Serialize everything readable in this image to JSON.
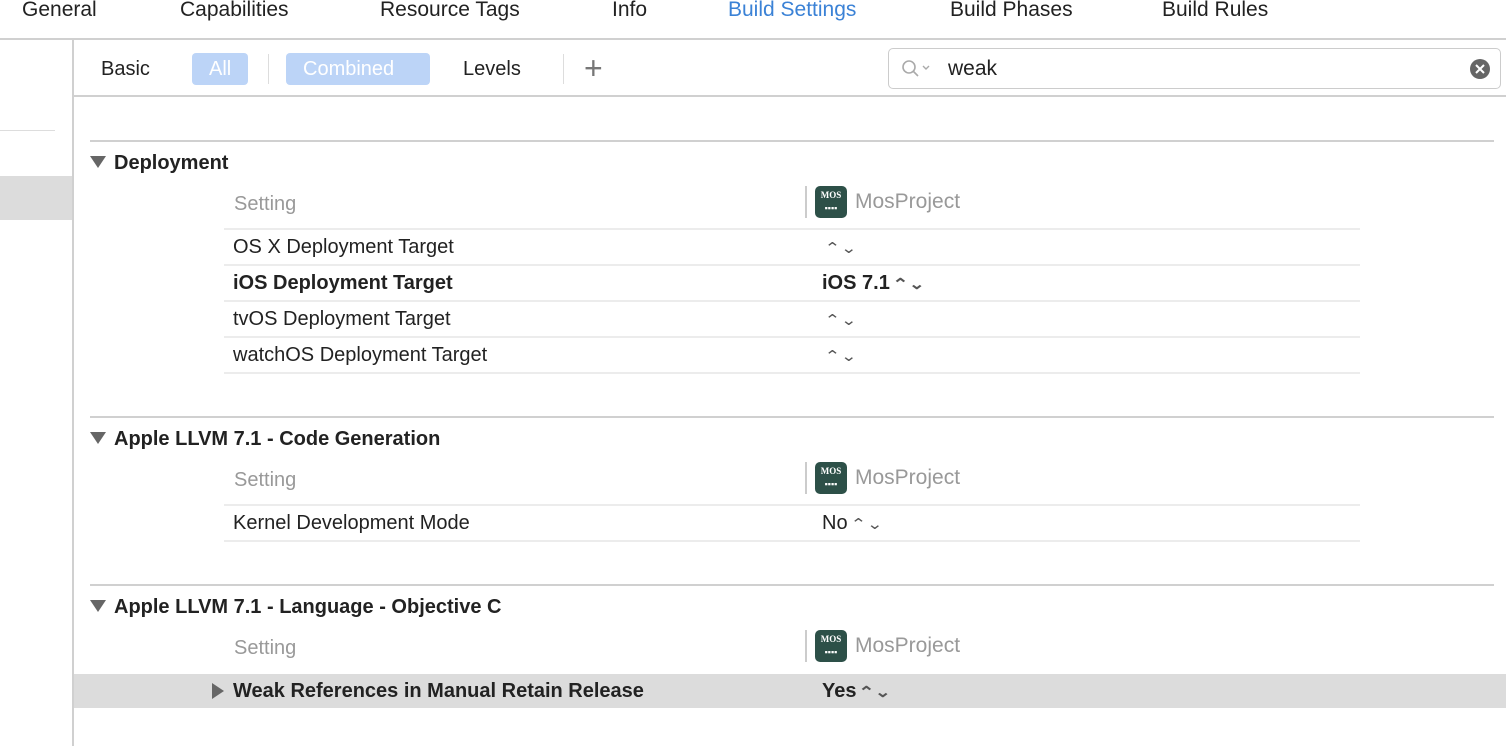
{
  "tabs": [
    {
      "label": "General"
    },
    {
      "label": "Capabilities"
    },
    {
      "label": "Resource Tags"
    },
    {
      "label": "Info"
    },
    {
      "label": "Build Settings",
      "active": true
    },
    {
      "label": "Build Phases"
    },
    {
      "label": "Build Rules"
    }
  ],
  "toolbar": {
    "basic": "Basic",
    "all": "All",
    "combined": "Combined",
    "levels": "Levels",
    "add": "+"
  },
  "search": {
    "value": "weak"
  },
  "accent": "#3b82d6",
  "sections": [
    {
      "title": "Deployment",
      "setting_header": "Setting",
      "project": "MosProject",
      "logo_text": "MOS",
      "rows": [
        {
          "name": "OS X Deployment Target",
          "value": "",
          "bold": false
        },
        {
          "name": "iOS Deployment Target",
          "value": "iOS 7.1",
          "bold": true
        },
        {
          "name": "tvOS Deployment Target",
          "value": "",
          "bold": false
        },
        {
          "name": "watchOS Deployment Target",
          "value": "",
          "bold": false
        }
      ]
    },
    {
      "title": "Apple LLVM 7.1 - Code Generation",
      "setting_header": "Setting",
      "project": "MosProject",
      "logo_text": "MOS",
      "rows": [
        {
          "name": "Kernel Development Mode",
          "value": "No",
          "bold": false
        }
      ]
    },
    {
      "title": "Apple LLVM 7.1 - Language - Objective C",
      "setting_header": "Setting",
      "project": "MosProject",
      "logo_text": "MOS",
      "rows": [
        {
          "name": "Weak References in Manual Retain Release",
          "value": "Yes",
          "bold": true,
          "selected": true
        }
      ]
    }
  ]
}
